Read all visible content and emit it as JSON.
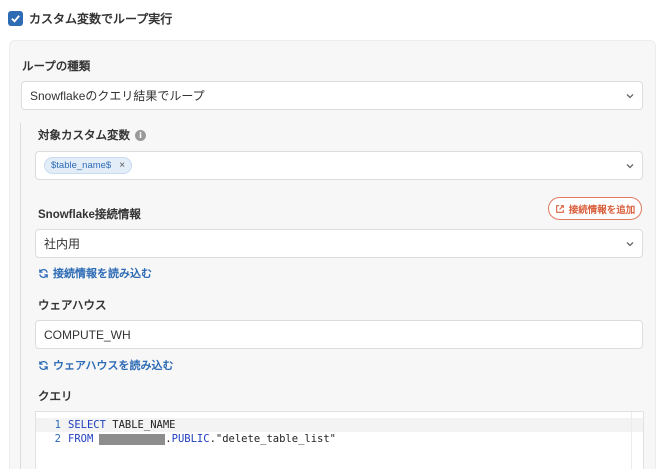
{
  "header": {
    "loop_checkbox_label": "カスタム変数でループ実行",
    "checked": true
  },
  "loop_type": {
    "label": "ループの種類",
    "value": "Snowflakeのクエリ結果でループ"
  },
  "target_var": {
    "label": "対象カスタム変数",
    "info_icon": "info-icon",
    "chip": "$table_name$",
    "chip_remove": "×"
  },
  "connection": {
    "label": "Snowflake接続情報",
    "add_button": "接続情報を追加",
    "value": "社内用",
    "reload_label": "接続情報を読み込む"
  },
  "warehouse": {
    "label": "ウェアハウス",
    "value": "COMPUTE_WH",
    "reload_label": "ウェアハウスを読み込む"
  },
  "query": {
    "label": "クエリ",
    "lines": [
      {
        "num": "1",
        "kw1": "SELECT",
        "rest": " TABLE_NAME"
      },
      {
        "num": "2",
        "kw1": "FROM",
        "mid": ".",
        "kw2": "PUBLIC",
        "rest": ".\"delete_table_list\""
      }
    ]
  },
  "colors": {
    "accent": "#2d6bb5",
    "add_button": "#d9603f",
    "panel_bg": "#f7f7f7"
  }
}
